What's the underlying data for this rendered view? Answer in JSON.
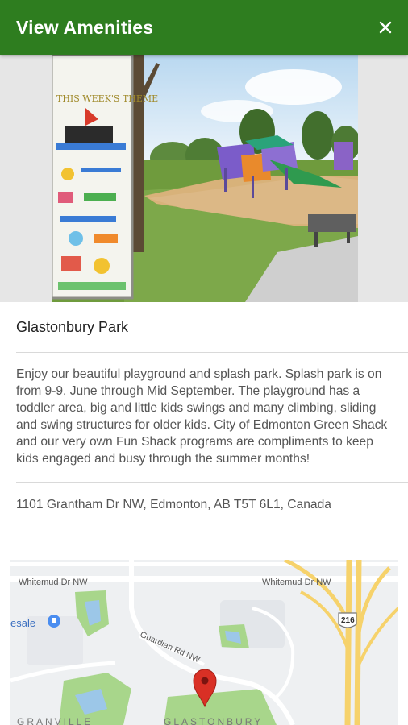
{
  "header": {
    "title": "View Amenities",
    "close_icon": "close-icon"
  },
  "photo": {
    "sign_text": "THIS WEEK'S THEME",
    "description": "park-photo"
  },
  "park": {
    "name": "Glastonbury Park",
    "description": "Enjoy our beautiful playground and splash park. Splash park is on from 9-9, June through Mid September. The playground has a toddler area, big and little kids swings and many climbing, sliding and swing structures for older kids. City of Edmonton Green Shack and our very own Fun Shack programs are compliments to keep kids engaged and busy through the summer months!",
    "address": "1101 Grantham Dr NW, Edmonton, AB T5T 6L1, Canada"
  },
  "map": {
    "labels": {
      "road_left": "Whitemud Dr NW",
      "road_right": "Whitemud Dr NW",
      "guardian": "Guardian Rd NW",
      "highway": "216",
      "place_partial": "esale",
      "area_left": "GRANVILLE",
      "area_main": "GLASTONBURY"
    },
    "colors": {
      "header": "#2e7d1f",
      "marker": "#d93025",
      "park_green": "#a8d68b",
      "highway_yellow": "#f6d26b"
    }
  }
}
